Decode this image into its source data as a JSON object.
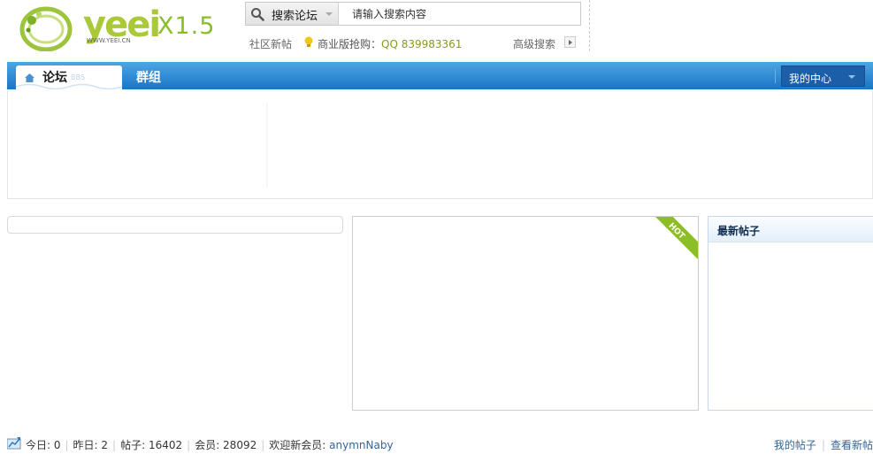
{
  "logo": {
    "word": "yeei",
    "version": "X1.5",
    "url": "WWW.YEEI.CN"
  },
  "search": {
    "type_label": "搜索论坛",
    "placeholder": "请输入搜索内容",
    "hotwords": "社区新帖",
    "promo_label": "商业版抢购：",
    "promo_qq": "QQ 839983361",
    "advanced_label": "高级搜索"
  },
  "nav": {
    "active_tab": "论坛",
    "active_tab_sub": "BBS",
    "items": [
      "群组"
    ],
    "my_center": "我的中心"
  },
  "panels": {
    "hot_badge": "HOT",
    "latest_title": "最新帖子"
  },
  "stats": {
    "today": "今日: 0",
    "yesterday": "昨日: 2",
    "posts": "帖子: 16402",
    "members": "会员: 28092",
    "welcome": "欢迎新会员: ",
    "new_member": "anymnNaby"
  },
  "footer_links": {
    "my_posts": "我的帖子",
    "view_new": "查看新帖"
  },
  "colors": {
    "nav_blue": "#1a75c5",
    "accent_green": "#8cbf26",
    "link_blue": "#336699"
  }
}
